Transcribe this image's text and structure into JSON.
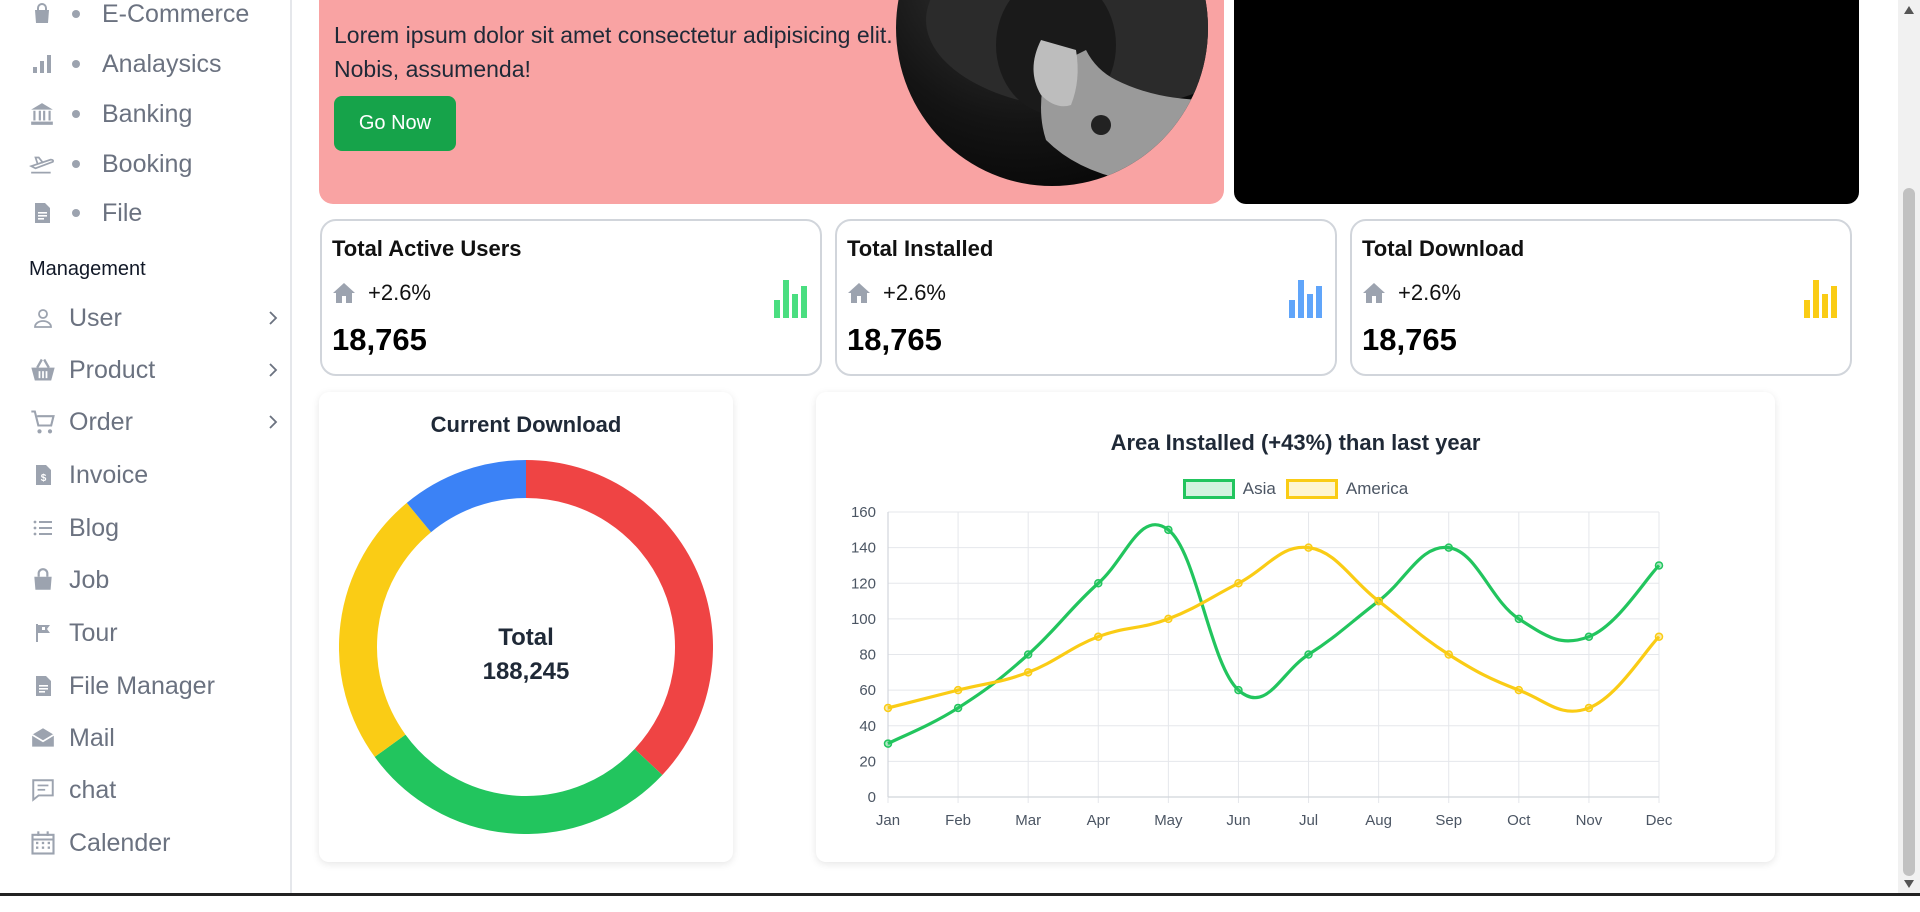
{
  "sidebar": {
    "sub_items": [
      {
        "label": "E-Commerce",
        "icon": "bag-icon"
      },
      {
        "label": "Analaysics",
        "icon": "bar-chart-icon"
      },
      {
        "label": "Banking",
        "icon": "bank-icon"
      },
      {
        "label": "Booking",
        "icon": "airplane-icon"
      },
      {
        "label": "File",
        "icon": "file-icon"
      }
    ],
    "section_title": "Management",
    "items": [
      {
        "label": "User",
        "icon": "user-icon",
        "has_children": true
      },
      {
        "label": "Product",
        "icon": "basket-icon",
        "has_children": true
      },
      {
        "label": "Order",
        "icon": "cart-icon",
        "has_children": true
      },
      {
        "label": "Invoice",
        "icon": "invoice-icon",
        "has_children": false
      },
      {
        "label": "Blog",
        "icon": "list-icon",
        "has_children": false
      },
      {
        "label": "Job",
        "icon": "briefcase-icon",
        "has_children": false
      },
      {
        "label": "Tour",
        "icon": "flag-icon",
        "has_children": false
      },
      {
        "label": "File Manager",
        "icon": "file-icon",
        "has_children": false
      },
      {
        "label": "Mail",
        "icon": "mail-icon",
        "has_children": false
      },
      {
        "label": "chat",
        "icon": "chat-icon",
        "has_children": false
      },
      {
        "label": "Calender",
        "icon": "calendar-icon",
        "has_children": false
      }
    ]
  },
  "banner": {
    "text": "Lorem ipsum dolor sit amet consectetur adipisicing elit. Nobis, assumenda!",
    "button_label": "Go Now",
    "background": "#f9a3a3",
    "button_color": "#16a34a"
  },
  "stats": [
    {
      "title": "Total Active Users",
      "change": "+2.6%",
      "value": "18,765",
      "color": "#4ade80"
    },
    {
      "title": "Total Installed",
      "change": "+2.6%",
      "value": "18,765",
      "color": "#60a5fa"
    },
    {
      "title": "Total Download",
      "change": "+2.6%",
      "value": "18,765",
      "color": "#facc15"
    }
  ],
  "donut": {
    "title": "Current Download",
    "center_label": "Total",
    "center_value": "188,245"
  },
  "line_chart": {
    "title": "Area Installed (+43%) than last year"
  },
  "chart_data": [
    {
      "type": "pie",
      "title": "Current Download",
      "donut": true,
      "slices": [
        {
          "value": 37,
          "color": "#ef4444"
        },
        {
          "value": 28,
          "color": "#22c55e"
        },
        {
          "value": 24,
          "color": "#facc15"
        },
        {
          "value": 11,
          "color": "#3b82f6"
        }
      ]
    },
    {
      "type": "line",
      "title": "Area Installed (+43%) than last year",
      "categories": [
        "Jan",
        "Feb",
        "Mar",
        "Apr",
        "May",
        "Jun",
        "Jul",
        "Aug",
        "Sep",
        "Oct",
        "Nov",
        "Dec"
      ],
      "series": [
        {
          "name": "Asia",
          "color": "#22c55e",
          "values": [
            30,
            50,
            80,
            120,
            150,
            60,
            80,
            110,
            140,
            100,
            90,
            130
          ]
        },
        {
          "name": "America",
          "color": "#facc15",
          "values": [
            50,
            60,
            70,
            90,
            100,
            120,
            140,
            110,
            80,
            60,
            50,
            90
          ]
        }
      ],
      "ylim": [
        0,
        160
      ],
      "yticks": [
        "0",
        "20",
        "40",
        "60",
        "80",
        "100",
        "120",
        "140",
        "160"
      ],
      "grid": true,
      "legend": "top-center"
    }
  ]
}
